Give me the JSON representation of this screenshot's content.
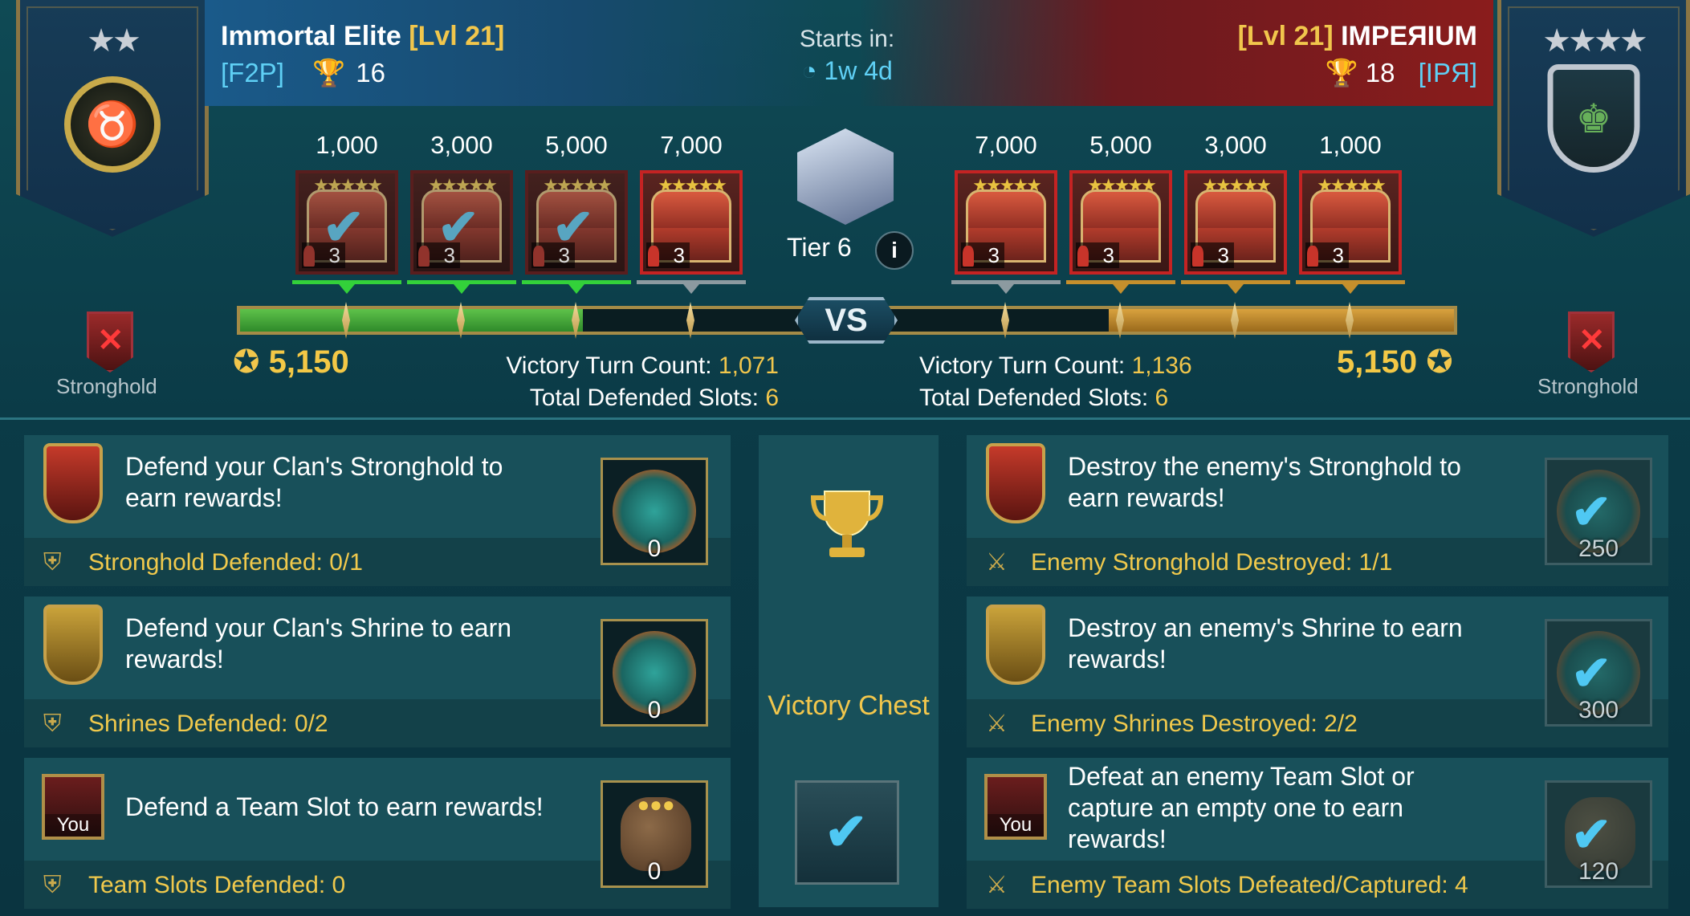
{
  "left_clan": {
    "name": "Immortal Elite",
    "level": "[Lvl 21]",
    "tag": "[F2P]",
    "trophies": "16",
    "score": "5,150"
  },
  "right_clan": {
    "name": "IMPEЯIUM",
    "level": "[Lvl 21]",
    "tag": "[IPЯ]",
    "trophies": "18",
    "score": "5,150"
  },
  "timer": {
    "label": "Starts in:",
    "value": "1w 4d"
  },
  "tier": {
    "label": "Tier 6",
    "info": "i"
  },
  "vs_label": "VS",
  "left_chests": [
    {
      "points": "1,000",
      "count": "3",
      "claimed": true
    },
    {
      "points": "3,000",
      "count": "3",
      "claimed": true
    },
    {
      "points": "5,000",
      "count": "3",
      "claimed": true
    },
    {
      "points": "7,000",
      "count": "3",
      "claimed": false
    }
  ],
  "right_chests": [
    {
      "points": "7,000",
      "count": "3",
      "claimed": false
    },
    {
      "points": "5,000",
      "count": "3",
      "claimed": false
    },
    {
      "points": "3,000",
      "count": "3",
      "claimed": false
    },
    {
      "points": "1,000",
      "count": "3",
      "claimed": false
    }
  ],
  "left_stats": {
    "victory_label": "Victory Turn Count:",
    "victory_value": "1,071",
    "slots_label": "Total Defended Slots:",
    "slots_value": "6"
  },
  "right_stats": {
    "victory_label": "Victory Turn Count:",
    "victory_value": "1,136",
    "slots_label": "Total Defended Slots:",
    "slots_value": "6"
  },
  "stronghold_label": "Stronghold",
  "progress": {
    "left_fraction": 0.6,
    "right_fraction": 0.6
  },
  "left_tasks": [
    {
      "text": "Defend your Clan's Stronghold to earn rewards!",
      "footer": "Stronghold Defended: 0/1",
      "reward": "0"
    },
    {
      "text": "Defend your Clan's Shrine to earn rewards!",
      "footer": "Shrines Defended: 0/2",
      "reward": "0"
    },
    {
      "text": "Defend a Team Slot to earn rewards!",
      "footer": "Team Slots Defended: 0",
      "reward": "0",
      "you": "You"
    }
  ],
  "right_tasks": [
    {
      "text": "Destroy the enemy's Stronghold to earn rewards!",
      "footer": "Enemy Stronghold Destroyed: 1/1",
      "reward": "250"
    },
    {
      "text": "Destroy an enemy's Shrine to earn rewards!",
      "footer": "Enemy Shrines Destroyed: 2/2",
      "reward": "300"
    },
    {
      "text": "Defeat an enemy Team Slot or capture an empty one to earn rewards!",
      "footer": "Enemy Team Slots Defeated/Captured: 4",
      "reward": "120",
      "you": "You"
    }
  ],
  "victory_chest_label": "Victory Chest",
  "colors": {
    "gold": "#f1c64c",
    "cyan": "#5fd0f5",
    "green_bar": "#4cad3c",
    "orange_bar": "#c58f2c"
  }
}
